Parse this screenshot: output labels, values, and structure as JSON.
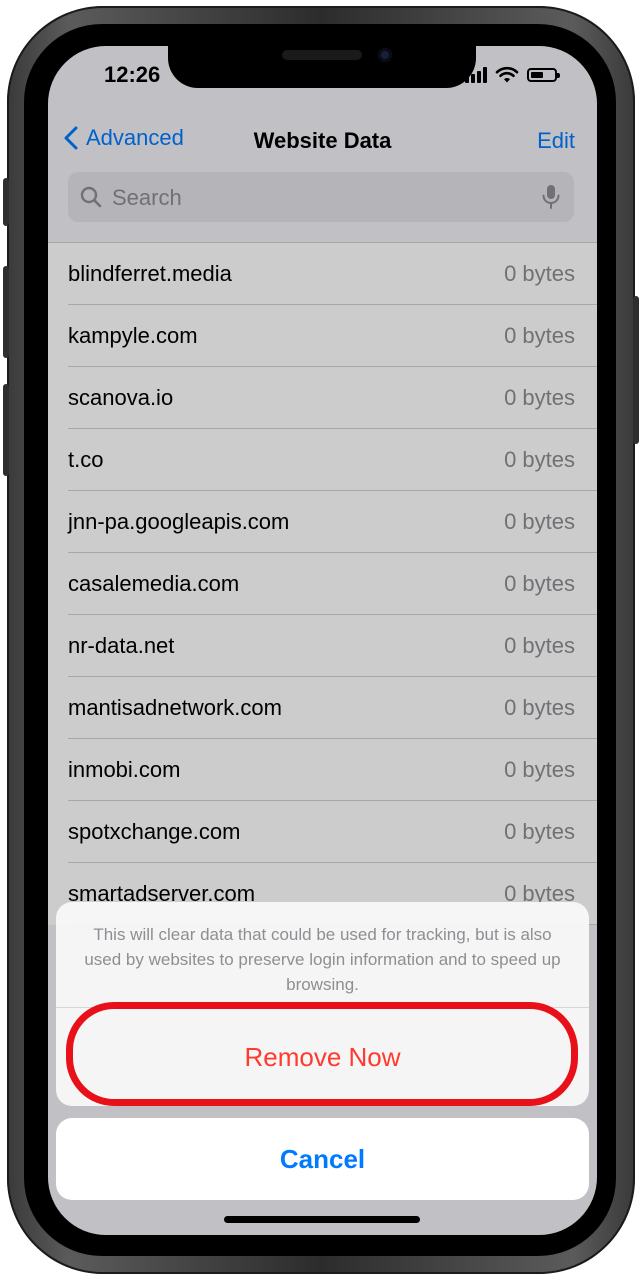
{
  "status_bar": {
    "time": "12:26"
  },
  "nav": {
    "back_label": "Advanced",
    "title": "Website Data",
    "edit_label": "Edit"
  },
  "search": {
    "placeholder": "Search"
  },
  "list": {
    "rows": [
      {
        "domain": "blindferret.media",
        "size": "0 bytes"
      },
      {
        "domain": "kampyle.com",
        "size": "0 bytes"
      },
      {
        "domain": "scanova.io",
        "size": "0 bytes"
      },
      {
        "domain": "t.co",
        "size": "0 bytes"
      },
      {
        "domain": "jnn-pa.googleapis.com",
        "size": "0 bytes"
      },
      {
        "domain": "casalemedia.com",
        "size": "0 bytes"
      },
      {
        "domain": "nr-data.net",
        "size": "0 bytes"
      },
      {
        "domain": "mantisadnetwork.com",
        "size": "0 bytes"
      },
      {
        "domain": "inmobi.com",
        "size": "0 bytes"
      },
      {
        "domain": "spotxchange.com",
        "size": "0 bytes"
      },
      {
        "domain": "smartadserver.com",
        "size": "0 bytes"
      }
    ]
  },
  "action_sheet": {
    "message": "This will clear data that could be used for tracking, but is also used by websites to preserve login information and to speed up browsing.",
    "remove_label": "Remove Now",
    "cancel_label": "Cancel"
  },
  "colors": {
    "accent": "#007aff",
    "destructive": "#ff3b30",
    "highlight_ring": "#e8111a"
  },
  "icons": {
    "back": "chevron-left-icon",
    "search": "magnifying-glass-icon",
    "mic": "microphone-icon",
    "wifi": "wifi-icon",
    "battery": "battery-icon",
    "signal": "cellular-signal-icon"
  },
  "battery_level": 0.55
}
